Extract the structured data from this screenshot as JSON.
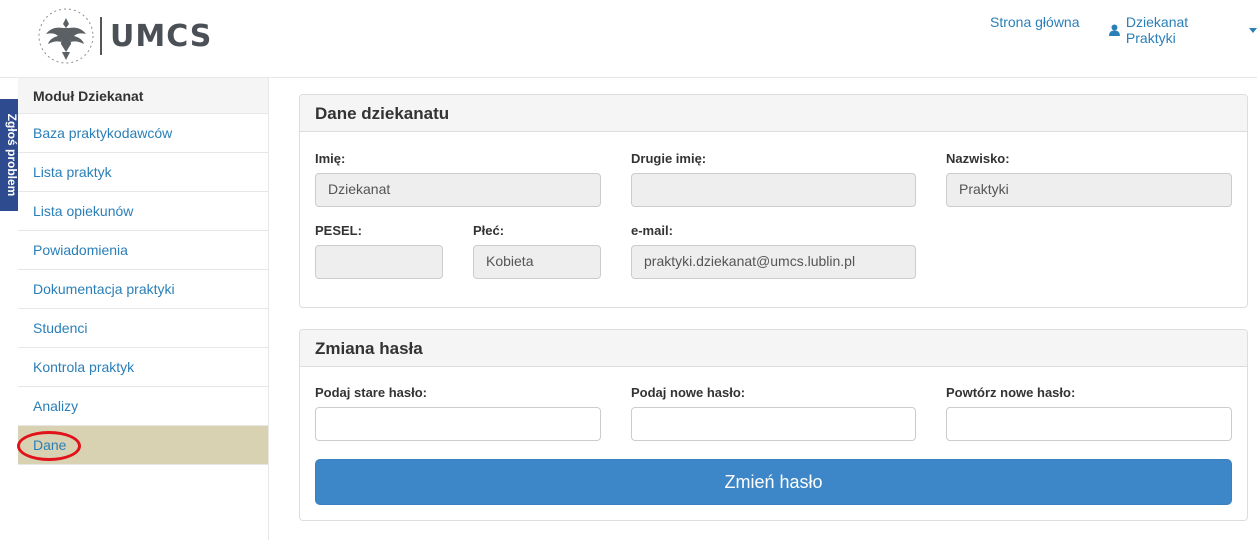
{
  "header": {
    "brand": "UMCS",
    "home_link": "Strona główna",
    "user_menu": "Dziekanat Praktyki",
    "user_icon": "user-icon"
  },
  "report_tab": {
    "label": "Zgłoś problem"
  },
  "sidebar": {
    "title": "Moduł Dziekanat",
    "items": [
      {
        "label": "Baza praktykodawców"
      },
      {
        "label": "Lista praktyk"
      },
      {
        "label": "Lista opiekunów"
      },
      {
        "label": "Powiadomienia"
      },
      {
        "label": "Dokumentacja praktyki"
      },
      {
        "label": "Studenci"
      },
      {
        "label": "Kontrola praktyk"
      },
      {
        "label": "Analizy"
      },
      {
        "label": "Dane",
        "active": true
      }
    ],
    "highlight_color": "#e1131a"
  },
  "dane_panel": {
    "title": "Dane dziekanatu",
    "imie_label": "Imię:",
    "imie_value": "Dziekanat",
    "drugie_imie_label": "Drugie imię:",
    "drugie_imie_value": "",
    "nazwisko_label": "Nazwisko:",
    "nazwisko_value": "Praktyki",
    "pesel_label": "PESEL:",
    "pesel_value": "",
    "plec_label": "Płeć:",
    "plec_value": "Kobieta",
    "email_label": "e-mail:",
    "email_value": "praktyki.dziekanat@umcs.lublin.pl"
  },
  "haslo_panel": {
    "title": "Zmiana hasła",
    "old_label": "Podaj stare hasło:",
    "new_label": "Podaj nowe hasło:",
    "repeat_label": "Powtórz nowe hasło:",
    "submit_label": "Zmień hasło"
  },
  "colors": {
    "accent": "#2a7fb8",
    "button": "#3d87c9",
    "active_item": "#d8d2b2",
    "report_tab": "#2e4b8f"
  }
}
